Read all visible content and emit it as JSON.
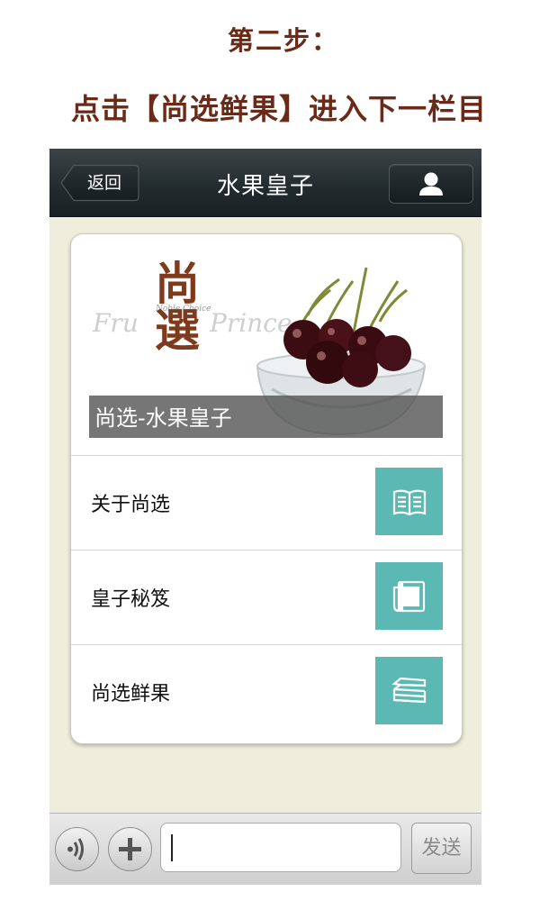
{
  "instruction": {
    "step": "第二步：",
    "action": "点击【尚选鲜果】进入下一栏目"
  },
  "navbar": {
    "back_label": "返回",
    "title": "水果皇子",
    "profile_icon": "user-icon"
  },
  "banner": {
    "logo_text": "尚選",
    "logo_script_left": "Fru",
    "logo_script_right": "Prince",
    "logo_small": "Noble Choice",
    "caption": "尚选-水果皇子"
  },
  "menu": {
    "items": [
      {
        "label": "关于尚选",
        "icon": "open-book-icon"
      },
      {
        "label": "皇子秘笈",
        "icon": "notebook-icon"
      },
      {
        "label": "尚选鲜果",
        "icon": "stacked-papers-icon"
      }
    ]
  },
  "colors": {
    "instruction_text": "#6b2a17",
    "tile": "#5cb8b2",
    "background": "#efeedc",
    "navbar": "#212a2d"
  },
  "bottombar": {
    "voice_icon": "voice-icon",
    "plus_icon": "plus-icon",
    "input_value": "",
    "send_label": "发送"
  }
}
